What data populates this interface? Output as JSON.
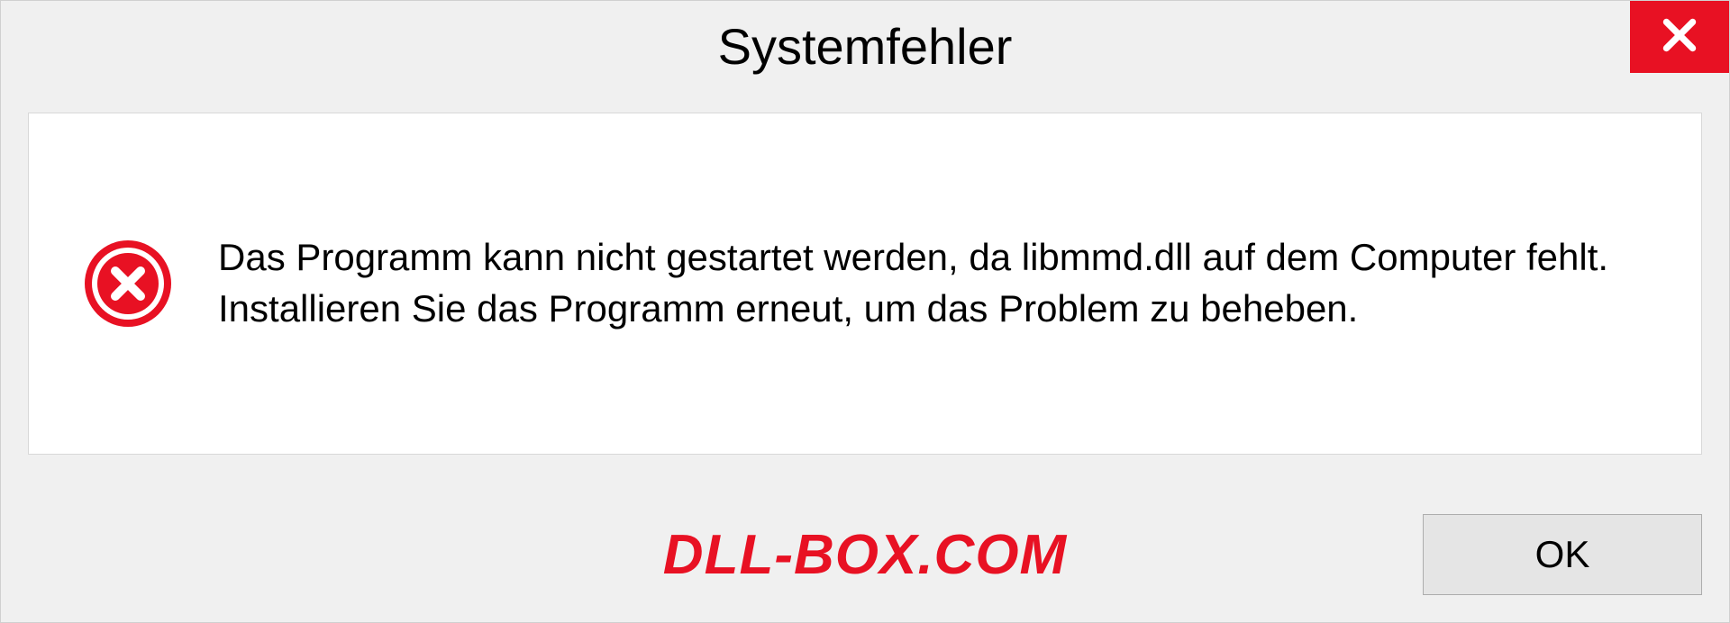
{
  "dialog": {
    "title": "Systemfehler",
    "message": "Das Programm kann nicht gestartet werden, da libmmd.dll auf dem Computer fehlt. Installieren Sie das Programm erneut, um das Problem zu beheben.",
    "ok_label": "OK"
  },
  "watermark": "DLL-BOX.COM"
}
